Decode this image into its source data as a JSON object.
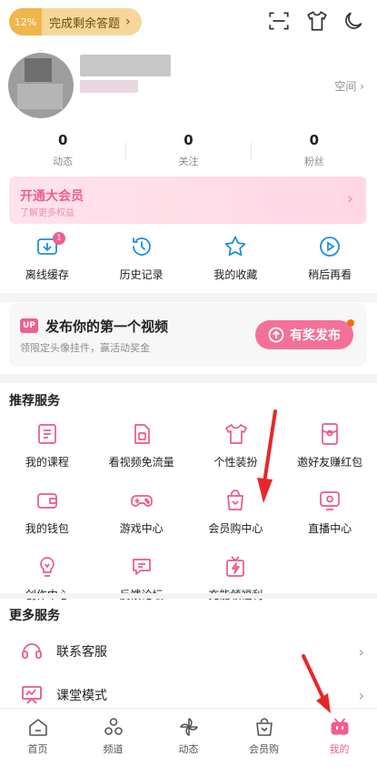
{
  "header": {
    "quiz_percent": "12%",
    "quiz_label": "完成剩余答题",
    "quiz_arrow": "›",
    "icons": [
      "scan-icon",
      "tshirt-icon",
      "moon-icon"
    ]
  },
  "profile": {
    "space_label": "空间 ›"
  },
  "stats": [
    {
      "value": "0",
      "label": "动态"
    },
    {
      "value": "0",
      "label": "关注"
    },
    {
      "value": "0",
      "label": "粉丝"
    }
  ],
  "vip": {
    "title": "开通大会员",
    "subtitle": "了解更多权益",
    "arrow": "›"
  },
  "quick_actions": [
    {
      "label": "离线缓存",
      "badge": "1",
      "icon": "download-icon"
    },
    {
      "label": "历史记录",
      "icon": "history-icon"
    },
    {
      "label": "我的收藏",
      "icon": "star-icon"
    },
    {
      "label": "稍后再看",
      "icon": "watch-later-icon"
    }
  ],
  "upload": {
    "badge": "UP",
    "title": "发布你的第一个视频",
    "subtitle": "领限定头像挂件，赢活动奖金",
    "button": "有奖发布"
  },
  "recommended": {
    "title": "推荐服务",
    "items": [
      {
        "label": "我的课程",
        "icon": "course-icon"
      },
      {
        "label": "看视频免流量",
        "icon": "sim-card-icon"
      },
      {
        "label": "个性装扮",
        "icon": "tshirt-icon"
      },
      {
        "label": "邀好友赚红包",
        "icon": "red-packet-icon"
      },
      {
        "label": "我的钱包",
        "icon": "wallet-icon"
      },
      {
        "label": "游戏中心",
        "icon": "gamepad-icon"
      },
      {
        "label": "会员购中心",
        "icon": "shopping-bag-icon"
      },
      {
        "label": "直播中心",
        "icon": "live-tv-icon"
      },
      {
        "label": "创作中心",
        "icon": "bulb-icon"
      },
      {
        "label": "反馈论坛",
        "icon": "chat-icon"
      },
      {
        "label": "充能领福利",
        "icon": "gift-bolt-icon"
      }
    ]
  },
  "more_services": {
    "title": "更多服务",
    "items": [
      {
        "label": "联系客服",
        "icon": "headset-icon"
      },
      {
        "label": "课堂模式",
        "icon": "classroom-icon"
      }
    ],
    "arrow": "›"
  },
  "tabbar": [
    {
      "label": "首页",
      "icon": "home-icon"
    },
    {
      "label": "频道",
      "icon": "channel-icon"
    },
    {
      "label": "动态",
      "icon": "pinwheel-icon"
    },
    {
      "label": "会员购",
      "icon": "shopping-bag-icon"
    },
    {
      "label": "我的",
      "icon": "tv-icon",
      "active": true
    }
  ],
  "colors": {
    "accent": "#f25d8e",
    "vip_bg": "#ffe3ec",
    "quiz_bg": "#f6d79a",
    "annotation_arrow": "#e8262a"
  }
}
